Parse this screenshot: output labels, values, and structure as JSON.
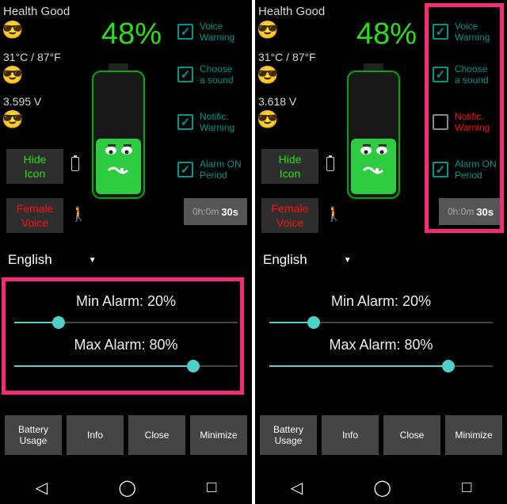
{
  "panes": [
    {
      "health": "Health Good",
      "temp": "31°C / 87°F",
      "volt": "3.595 V",
      "percent": "48%",
      "hide_icon": {
        "l1": "Hide",
        "l2": "Icon"
      },
      "female_voice": {
        "l1": "Female",
        "l2": "Voice"
      },
      "opts": {
        "voice": {
          "checked": true,
          "l1": "Voice",
          "l2": "Warning",
          "red": false
        },
        "sound": {
          "checked": true,
          "l1": "Choose",
          "l2": "a sound",
          "red": false
        },
        "notif": {
          "checked": true,
          "l1": "Notific.",
          "l2": "Warning",
          "red": false
        },
        "alarm": {
          "checked": true,
          "l1": "Alarm ON",
          "l2": "Period",
          "red": false
        }
      },
      "period": {
        "dim": "0h:0m",
        "bold": "30s"
      },
      "lang": "English",
      "sliders": {
        "min_label": "Min Alarm: 20%",
        "min_pct": 20,
        "max_label": "Max Alarm: 80%",
        "max_pct": 80,
        "highlight": true
      },
      "buttons": {
        "b1": "Battery\nUsage",
        "b2": "Info",
        "b3": "Close",
        "b4": "Minimize"
      },
      "highlight_opts": false
    },
    {
      "health": "Health Good",
      "temp": "31°C / 87°F",
      "volt": "3.618 V",
      "percent": "48%",
      "hide_icon": {
        "l1": "Hide",
        "l2": "Icon"
      },
      "female_voice": {
        "l1": "Female",
        "l2": "Voice"
      },
      "opts": {
        "voice": {
          "checked": true,
          "l1": "Voice",
          "l2": "Warning",
          "red": false
        },
        "sound": {
          "checked": true,
          "l1": "Choose",
          "l2": "a sound",
          "red": false
        },
        "notif": {
          "checked": false,
          "l1": "Notific.",
          "l2": "Warning",
          "red": true
        },
        "alarm": {
          "checked": true,
          "l1": "Alarm ON",
          "l2": "Period",
          "red": false
        }
      },
      "period": {
        "dim": "0h:0m",
        "bold": "30s"
      },
      "lang": "English",
      "sliders": {
        "min_label": "Min Alarm: 20%",
        "min_pct": 20,
        "max_label": "Max Alarm: 80%",
        "max_pct": 80,
        "highlight": false
      },
      "buttons": {
        "b1": "Battery\nUsage",
        "b2": "Info",
        "b3": "Close",
        "b4": "Minimize"
      },
      "highlight_opts": true
    }
  ]
}
